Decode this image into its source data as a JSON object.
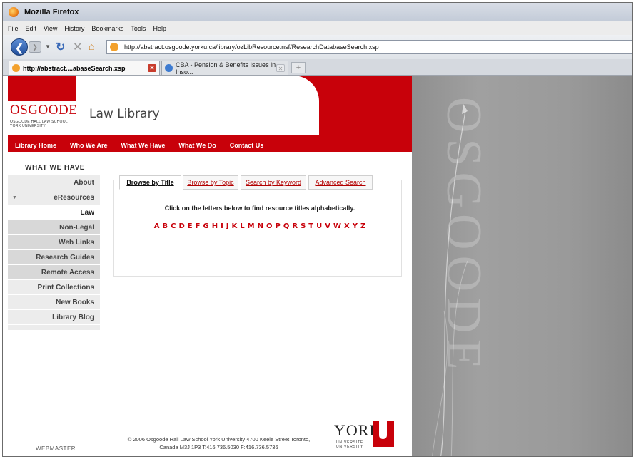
{
  "window": {
    "title": "Mozilla Firefox"
  },
  "menu": [
    "File",
    "Edit",
    "View",
    "History",
    "Bookmarks",
    "Tools",
    "Help"
  ],
  "nav": {
    "url": "http://abstract.osgoode.yorku.ca/library/ozLibResource.nsf/ResearchDatabaseSearch.xsp"
  },
  "tabs": [
    {
      "label": "http://abstract....abaseSearch.xsp"
    },
    {
      "label": "CBA - Pension & Benefits Issues in Inso..."
    }
  ],
  "header": {
    "logo": "OSGOODE",
    "logo_sub1": "OSGOODE HALL LAW SCHOOL",
    "logo_sub2": "YORK UNIVERSITY",
    "site_title": "Law Library"
  },
  "topnav": [
    "Library Home",
    "Who We Are",
    "What We Have",
    "What We Do",
    "Contact Us"
  ],
  "sidebar": {
    "heading": "WHAT WE HAVE",
    "items": [
      "About",
      "eResources",
      "Law",
      "Non-Legal",
      "Web Links",
      "Research Guides",
      "Remote Access",
      "Print Collections",
      "New Books",
      "Library Blog"
    ]
  },
  "search_tabs": [
    "Browse by Title",
    "Browse by Topic",
    "Search by Keyword",
    "Advanced Search"
  ],
  "instruction": "Click on the letters below to find resource titles alphabetically.",
  "letters": [
    "A",
    "B",
    "C",
    "D",
    "E",
    "F",
    "G",
    "H",
    "I",
    "J",
    "K",
    "L",
    "M",
    "N",
    "O",
    "P",
    "Q",
    "R",
    "S",
    "T",
    "U",
    "V",
    "W",
    "X",
    "Y",
    "Z"
  ],
  "footer": {
    "webmaster": "WEBMASTER",
    "copyright_line1": "© 2006 Osgoode Hall Law School York University 4700 Keele Street Toronto,",
    "copyright_line2": "Canada M3J 1P3 T:416.736.5030 F:416.736.5736",
    "york": "YORK",
    "york_sub1": "UNIVERSITÉ",
    "york_sub2": "UNIVERSITY"
  },
  "background_text": "OSGOODE",
  "colors": {
    "brand_red": "#c8010a",
    "panel_grey": "#9a9a9a"
  }
}
